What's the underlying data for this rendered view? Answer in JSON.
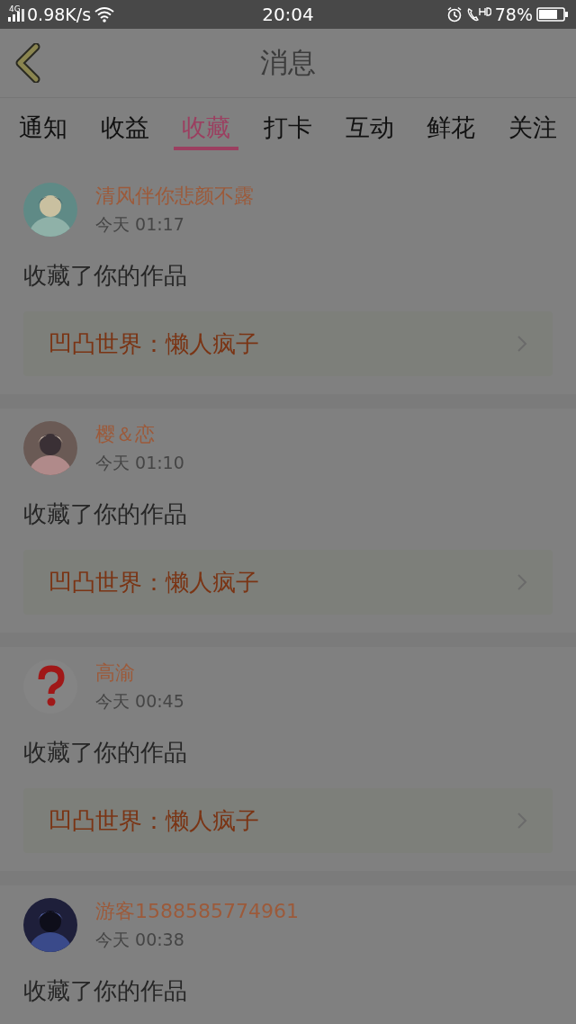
{
  "status_bar": {
    "network": "4G",
    "speed": "0.98K/s",
    "time": "20:04",
    "battery": "78%"
  },
  "header": {
    "title": "消息"
  },
  "tabs": [
    {
      "label": "通知",
      "selected": false
    },
    {
      "label": "收益",
      "selected": false
    },
    {
      "label": "收藏",
      "selected": true
    },
    {
      "label": "打卡",
      "selected": false
    },
    {
      "label": "互动",
      "selected": false
    },
    {
      "label": "鲜花",
      "selected": false
    },
    {
      "label": "关注",
      "selected": false
    }
  ],
  "messages": [
    {
      "user": "清风伴你悲颜不露",
      "time": "今天 01:17",
      "action": "收藏了你的作品",
      "work": "凹凸世界：懒人疯子"
    },
    {
      "user": "樱＆恋",
      "time": "今天 01:10",
      "action": "收藏了你的作品",
      "work": "凹凸世界：懒人疯子"
    },
    {
      "avatar": {
        "kind": "unknown"
      },
      "user": "高渝",
      "time": "今天 00:45",
      "action": "收藏了你的作品",
      "work": "凹凸世界：懒人疯子"
    },
    {
      "user": "游客1588585774961",
      "time": "今天 00:38",
      "action": "收藏了你的作品"
    }
  ]
}
